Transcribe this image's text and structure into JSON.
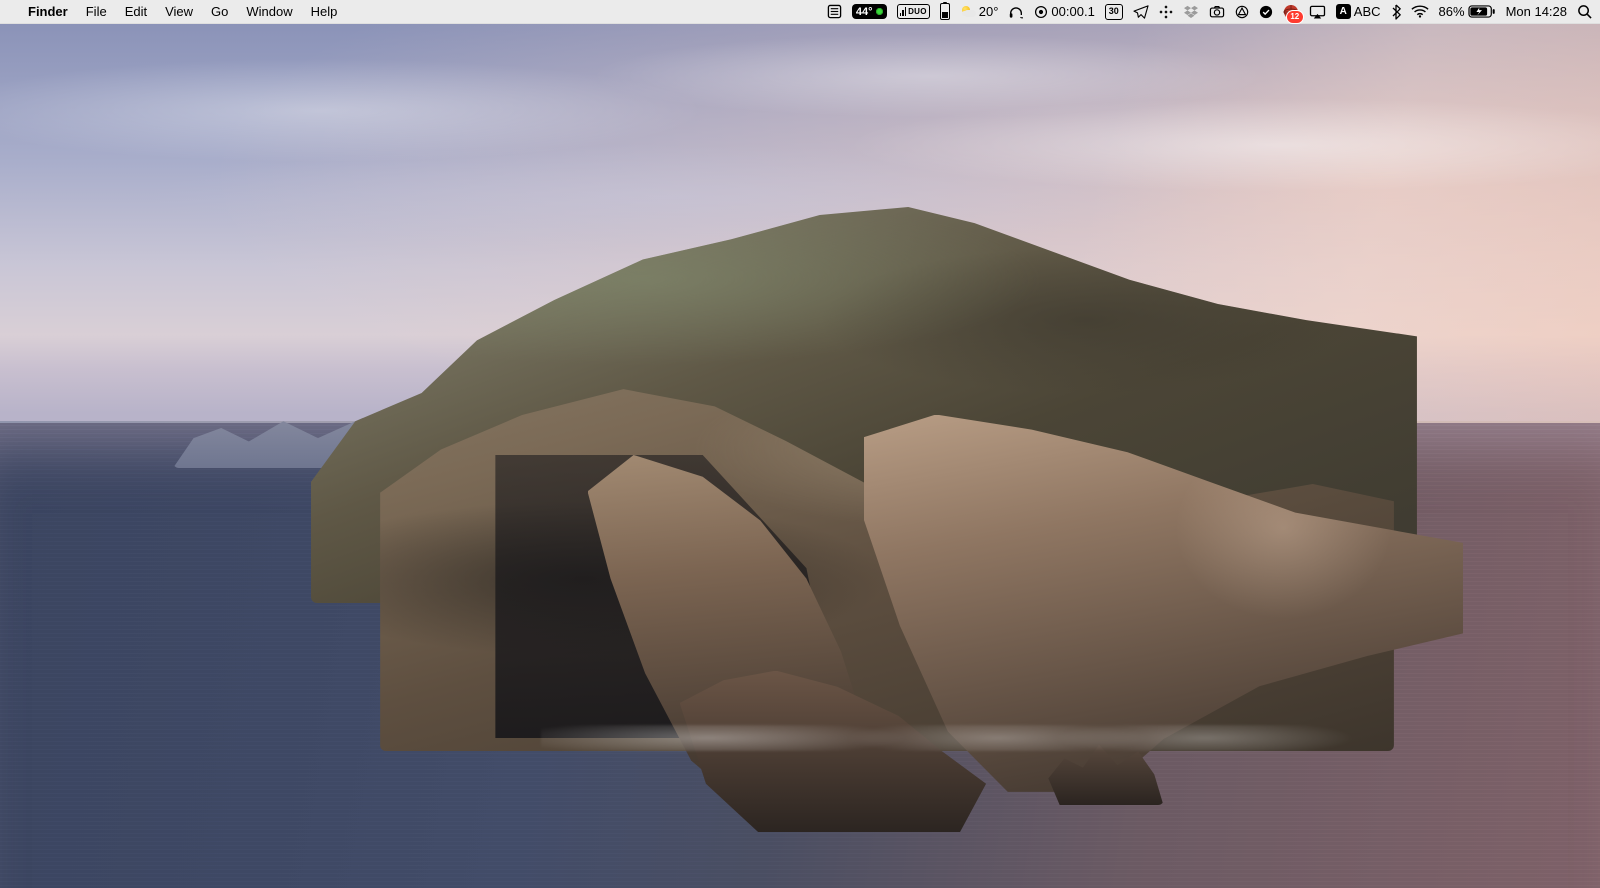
{
  "menubar": {
    "apple": "",
    "app": "Finder",
    "items": [
      "File",
      "Edit",
      "View",
      "Go",
      "Window",
      "Help"
    ]
  },
  "status": {
    "cpu_temp": "44°",
    "duo_label": "DUO",
    "weather_temp": "20°",
    "timer": "00:00.1",
    "calendar_day": "30",
    "notif_count": "12",
    "input_mode": "A",
    "input_label": "ABC",
    "battery_pct": "86%",
    "clock": "Mon 14:28"
  }
}
